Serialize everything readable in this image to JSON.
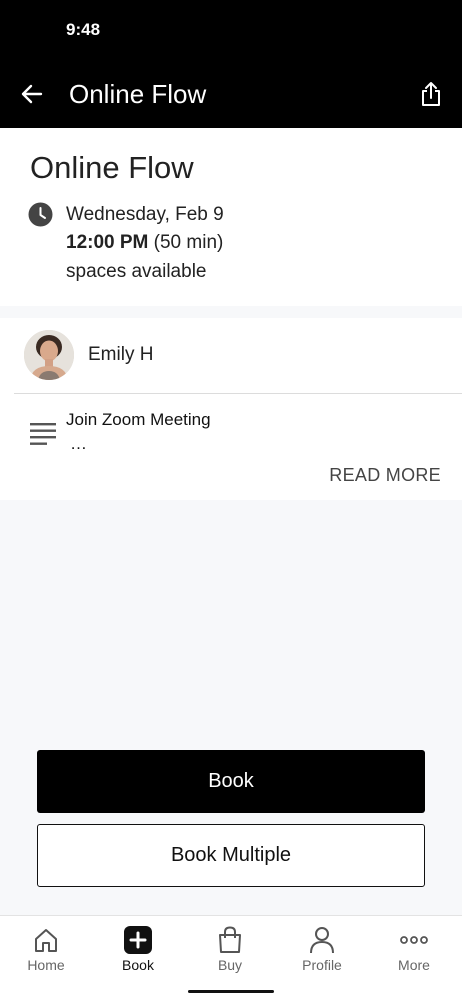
{
  "status_bar": {
    "time": "9:48"
  },
  "app_bar": {
    "title": "Online Flow",
    "back_icon": "arrow-left-icon",
    "share_icon": "share-icon"
  },
  "class_info": {
    "title": "Online Flow",
    "date": "Wednesday, Feb 9",
    "time": "12:00 PM",
    "duration": "(50 min)",
    "availability": "spaces available"
  },
  "instructor": {
    "name": "Emily H"
  },
  "description": {
    "line1": "Join Zoom Meeting",
    "line2": "…",
    "read_more": "READ MORE"
  },
  "actions": {
    "book": "Book",
    "book_multiple": "Book Multiple"
  },
  "tab_bar": {
    "active": "Book",
    "tabs": [
      {
        "label": "Home",
        "icon": "home-icon"
      },
      {
        "label": "Book",
        "icon": "plus-square-icon"
      },
      {
        "label": "Buy",
        "icon": "shopping-bag-icon"
      },
      {
        "label": "Profile",
        "icon": "person-icon"
      },
      {
        "label": "More",
        "icon": "more-dots-icon"
      }
    ]
  },
  "colors": {
    "header_bg": "#000000",
    "primary_button": "#000000",
    "page_bg": "#f7f8fa"
  }
}
